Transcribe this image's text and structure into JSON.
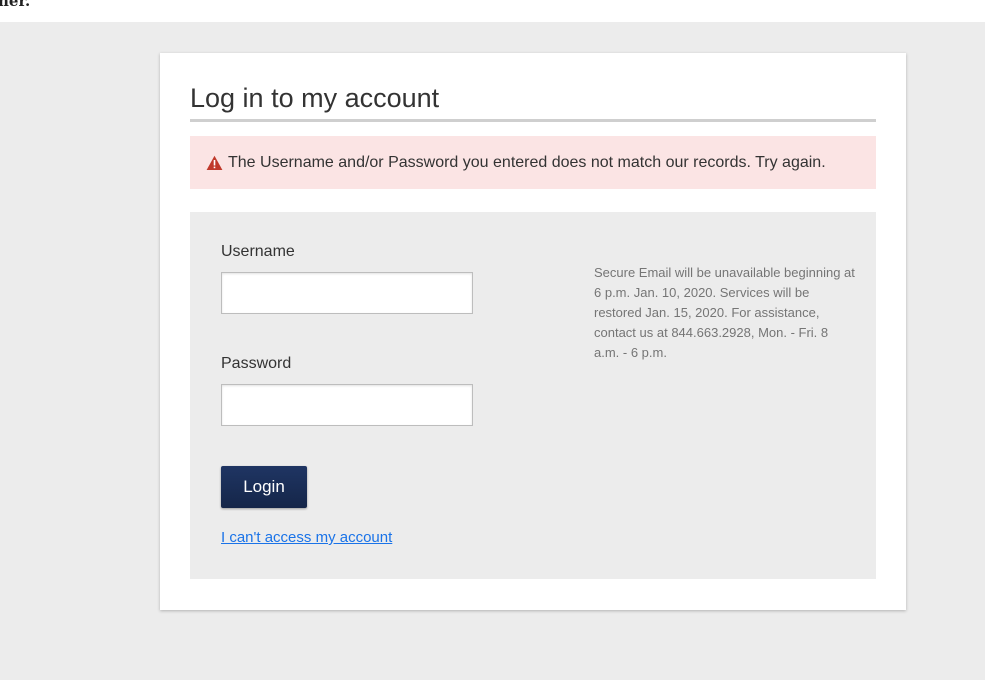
{
  "top_strip": {
    "text": "ner."
  },
  "card": {
    "title": "Log in to my account",
    "alert": {
      "icon": "warning-triangle-icon",
      "message": "The Username and/or Password you entered does not match our records. Try again.",
      "color": "#c0392b",
      "background": "#fbe4e4"
    },
    "form": {
      "username_label": "Username",
      "username_value": "",
      "password_label": "Password",
      "password_value": "",
      "login_label": "Login",
      "help_link": "I can't access my account"
    },
    "notice": "Secure Email will be unavailable beginning at 6 p.m. Jan. 10, 2020. Services will be restored Jan. 15, 2020. For assistance, contact us at 844.663.2928, Mon. - Fri. 8 a.m. - 6 p.m."
  },
  "colors": {
    "button": "#1f3563",
    "link": "#1a73e8",
    "page_background": "#ececec"
  }
}
